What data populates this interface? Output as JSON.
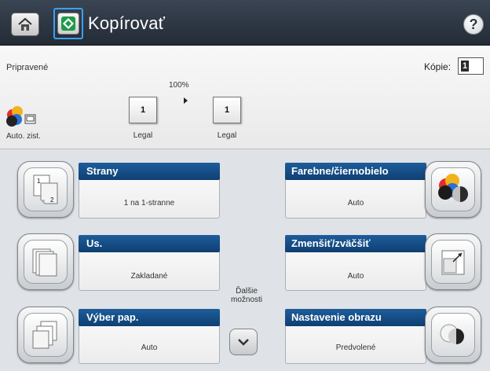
{
  "header": {
    "title": "Kopírovať",
    "home_icon": "home-icon",
    "start_icon": "start-copy-icon",
    "help_label": "?"
  },
  "status": {
    "text": "Pripravené",
    "copies_label": "Kópie:",
    "copies_value": "1"
  },
  "preview": {
    "auto_label": "Auto. zist.",
    "zoom": "100%",
    "original": {
      "number": "1",
      "label": "Legal"
    },
    "output": {
      "number": "1",
      "label": "Legal"
    }
  },
  "options": {
    "sides": {
      "title": "Strany",
      "value": "1 na 1-stranne"
    },
    "collate": {
      "title": "Us.",
      "value": "Zakladané"
    },
    "paper": {
      "title": "Výber pap.",
      "value": "Auto"
    },
    "color": {
      "title": "Farebne/čiernobielo",
      "value": "Auto"
    },
    "reduce": {
      "title": "Zmenšiť/zväčšiť",
      "value": "Auto"
    },
    "image": {
      "title": "Nastavenie obrazu",
      "value": "Predvolené"
    }
  },
  "more_options": {
    "label_line1": "Ďalšie",
    "label_line2": "možnosti"
  },
  "colors": {
    "header": "#2b333e",
    "title_bar": "#164f88",
    "accent": "#3aa0f2"
  }
}
